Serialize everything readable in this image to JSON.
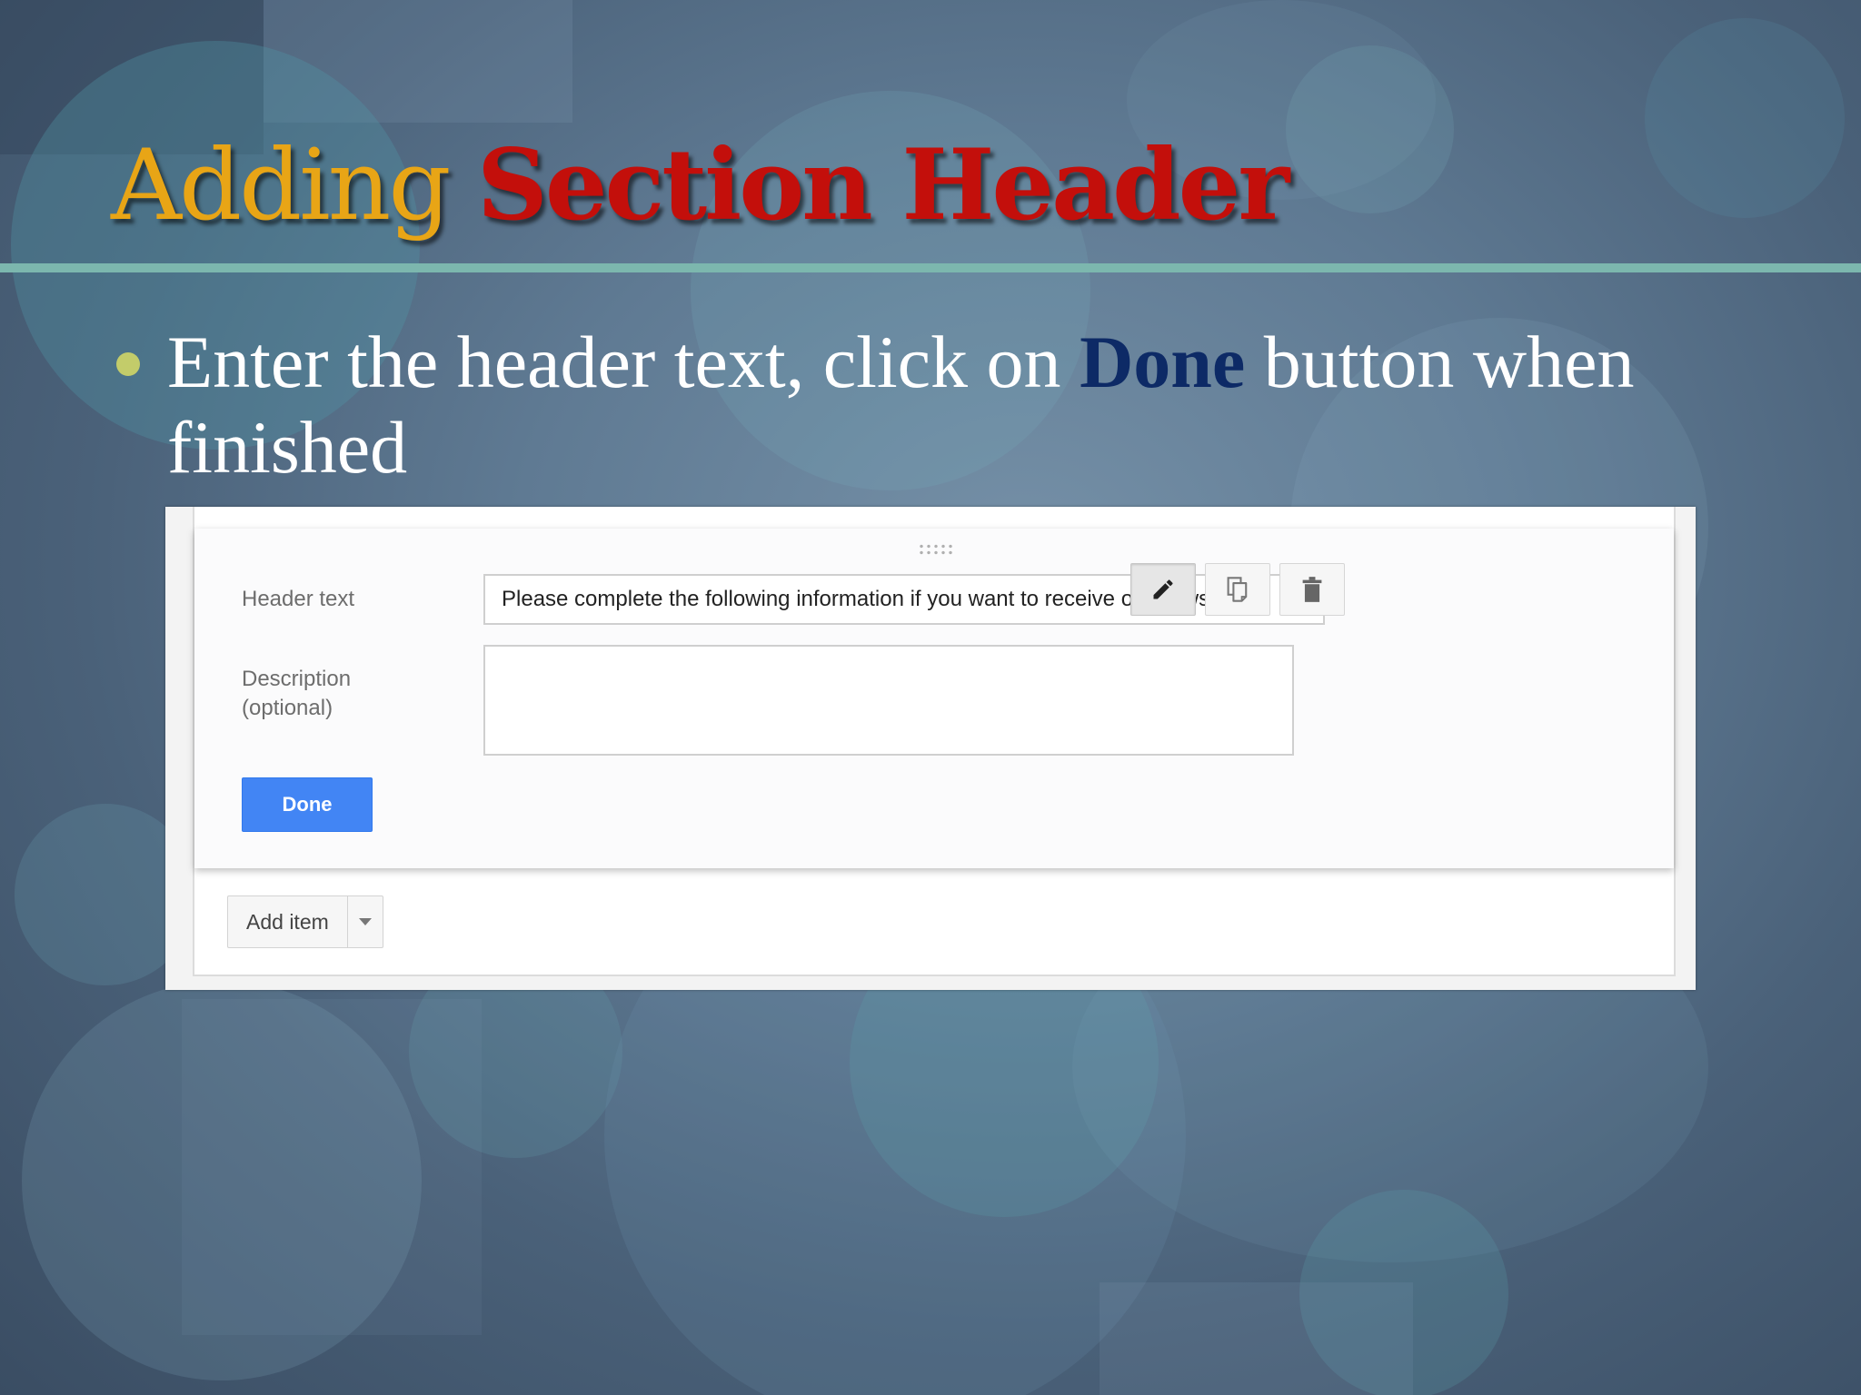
{
  "slide": {
    "title_part1": "Adding",
    "title_part2": "Section Header",
    "bullet_pre": "Enter the header text, click on ",
    "bullet_em": "Done",
    "bullet_post": " button when finished"
  },
  "form": {
    "header_label": "Header text",
    "header_value": "Please complete the following information if you want to receive our newslette",
    "description_label": "Description (optional)",
    "description_value": "",
    "done_label": "Done",
    "add_item_label": "Add item",
    "toolbar": {
      "edit_icon": "pencil-icon",
      "duplicate_icon": "duplicate-icon",
      "delete_icon": "trash-icon"
    }
  },
  "colors": {
    "title_part1": "#e8a516",
    "title_part2": "#c30f0b",
    "bullet_emphasis": "#0d2a66",
    "accent_rule": "#7cb7ae",
    "bullet_dot": "#c3cc6a",
    "done_button": "#4285f4"
  }
}
